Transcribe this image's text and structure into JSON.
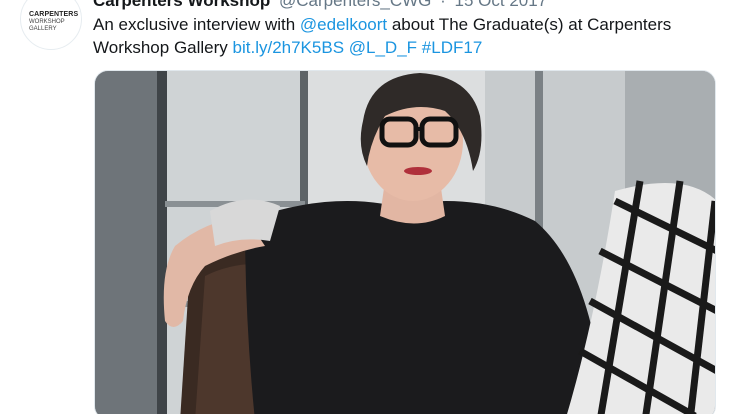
{
  "author": {
    "avatar_line1": "CARPENTERS",
    "avatar_line2": "WORKSHOP",
    "avatar_line3": "GALLERY",
    "name": "Carpenters Workshop",
    "handle": "@Carpenters_CWG",
    "date": "15 Oct 2017"
  },
  "tweet": {
    "text_prefix": "An exclusive interview with ",
    "mention_1": "@edelkoort",
    "text_middle": " about The Graduate(s) at Carpenters Workshop Gallery ",
    "link": "bit.ly/2h7K5BS",
    "mention_2": "@L_D_F",
    "hashtag": "#LDF17"
  },
  "colors": {
    "link": "#1b95e0",
    "text": "#14171a",
    "muted": "#657786"
  }
}
